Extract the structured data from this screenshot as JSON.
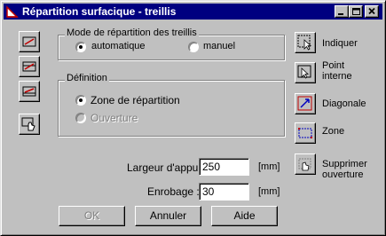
{
  "window": {
    "title": "Répartition surfacique - treillis"
  },
  "mode_group": {
    "legend": "Mode de répartition des treillis",
    "options": [
      {
        "label": "automatique",
        "selected": true,
        "enabled": true
      },
      {
        "label": "manuel",
        "selected": false,
        "enabled": true
      }
    ]
  },
  "definition_group": {
    "legend": "Définition",
    "options": [
      {
        "label": "Zone de répartition",
        "selected": true,
        "enabled": true
      },
      {
        "label": "Ouverture",
        "selected": false,
        "enabled": false
      }
    ]
  },
  "fields": {
    "largeur": {
      "label": "Largeur d'appui :",
      "value": "250",
      "unit": "[mm]"
    },
    "enrobage": {
      "label": "Enrobage :",
      "value": "30",
      "unit": "[mm]"
    }
  },
  "right_tools": [
    {
      "label_line1": "Indiquer",
      "label_line2": ""
    },
    {
      "label_line1": "Point",
      "label_line2": "interne"
    },
    {
      "label_line1": "Diagonale",
      "label_line2": ""
    },
    {
      "label_line1": "Zone",
      "label_line2": ""
    },
    {
      "label_line1": "Supprimer",
      "label_line2": "ouverture"
    }
  ],
  "buttons": {
    "ok": "OK",
    "cancel": "Annuler",
    "help": "Aide"
  },
  "colors": {
    "titlebar": "#000080",
    "face": "#c0c0c0",
    "accent": "#cc0000"
  }
}
